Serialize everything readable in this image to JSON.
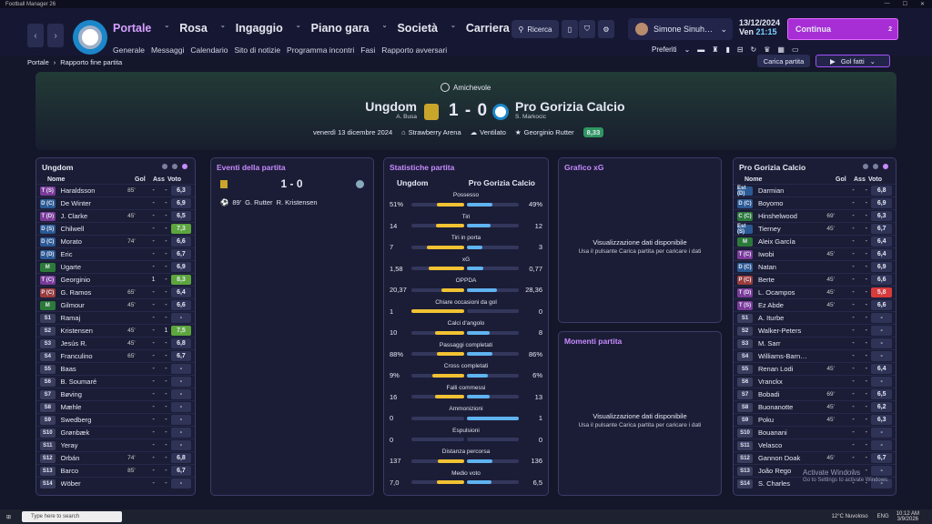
{
  "window": {
    "title": "Football Manager 26"
  },
  "nav": {
    "menu": [
      "Portale",
      "Rosa",
      "Ingaggio",
      "Piano gara",
      "Società",
      "Carriera"
    ],
    "submenu": [
      "Generale",
      "Messaggi",
      "Calendario",
      "Sito di notizie",
      "Programma incontri",
      "Fasi",
      "Rapporto avversari"
    ],
    "search": "Ricerca",
    "manager": "Simone Sinuh…",
    "date": "13/12/2024",
    "day": "Ven",
    "time": "21:15",
    "continue": "Continua",
    "notif": "2",
    "preferiti": "Preferiti"
  },
  "breadcrumb": [
    "Portale",
    "Rapporto fine partita"
  ],
  "actions": {
    "carica": "Carica partita",
    "gol": "Gol fatti"
  },
  "match": {
    "competition": "Amichevole",
    "home": "Ungdom",
    "home_coach": "A. Busa",
    "away": "Pro Gorizia Calcio",
    "away_coach": "S. Markocic",
    "score": "1 - 0",
    "date": "venerdì 13 dicembre 2024",
    "stadium": "Strawberry Arena",
    "weather": "Ventilato",
    "motm": "Georginio Rutter",
    "motm_rating": "8,33"
  },
  "home_panel": {
    "title": "Ungdom",
    "cols": [
      "Nome",
      "Gol",
      "Ass",
      "Voto"
    ],
    "players": [
      {
        "pos": "T (S)",
        "name": "Haraldsson",
        "sub": "85'",
        "gol": "-",
        "ass": "-",
        "r": "6,3",
        "c": ""
      },
      {
        "pos": "D (C)",
        "name": "De Winter",
        "sub": "",
        "gol": "-",
        "ass": "-",
        "r": "6,9",
        "c": ""
      },
      {
        "pos": "T (D)",
        "name": "J. Clarke",
        "sub": "45'",
        "gol": "-",
        "ass": "-",
        "r": "6,5",
        "c": ""
      },
      {
        "pos": "D (S)",
        "name": "Chilwell",
        "sub": "",
        "gol": "-",
        "ass": "-",
        "r": "7,3",
        "c": "g"
      },
      {
        "pos": "D (C)",
        "name": "Morato",
        "sub": "74'",
        "gol": "-",
        "ass": "-",
        "r": "6,6",
        "c": ""
      },
      {
        "pos": "D (D)",
        "name": "Eric",
        "sub": "",
        "gol": "-",
        "ass": "-",
        "r": "6,7",
        "c": ""
      },
      {
        "pos": "M",
        "name": "Ugarte",
        "sub": "",
        "gol": "-",
        "ass": "-",
        "r": "6,9",
        "c": ""
      },
      {
        "pos": "T (C)",
        "name": "Georginio",
        "sub": "",
        "gol": "1",
        "ass": "-",
        "r": "8,3",
        "c": "g"
      },
      {
        "pos": "P (C)",
        "name": "G. Ramos",
        "sub": "65'",
        "gol": "-",
        "ass": "-",
        "r": "6,4",
        "c": ""
      },
      {
        "pos": "M",
        "name": "Gilmour",
        "sub": "45'",
        "gol": "-",
        "ass": "-",
        "r": "6,6",
        "c": ""
      },
      {
        "pos": "S1",
        "name": "Ramaj",
        "sub": "",
        "gol": "-",
        "ass": "-",
        "r": "-",
        "c": ""
      },
      {
        "pos": "S2",
        "name": "Kristensen",
        "sub": "45'",
        "gol": "-",
        "ass": "1",
        "r": "7,5",
        "c": "g"
      },
      {
        "pos": "S3",
        "name": "Jesús R.",
        "sub": "45'",
        "gol": "-",
        "ass": "-",
        "r": "6,8",
        "c": ""
      },
      {
        "pos": "S4",
        "name": "Franculino",
        "sub": "65'",
        "gol": "-",
        "ass": "-",
        "r": "6,7",
        "c": ""
      },
      {
        "pos": "S5",
        "name": "Baas",
        "sub": "",
        "gol": "-",
        "ass": "-",
        "r": "-",
        "c": ""
      },
      {
        "pos": "S6",
        "name": "B. Soumaré",
        "sub": "",
        "gol": "-",
        "ass": "-",
        "r": "-",
        "c": ""
      },
      {
        "pos": "S7",
        "name": "Bøving",
        "sub": "",
        "gol": "-",
        "ass": "-",
        "r": "-",
        "c": ""
      },
      {
        "pos": "S8",
        "name": "Mæhle",
        "sub": "",
        "gol": "-",
        "ass": "-",
        "r": "-",
        "c": ""
      },
      {
        "pos": "S9",
        "name": "Swedberg",
        "sub": "",
        "gol": "-",
        "ass": "-",
        "r": "-",
        "c": ""
      },
      {
        "pos": "S10",
        "name": "Grønbæk",
        "sub": "",
        "gol": "-",
        "ass": "-",
        "r": "-",
        "c": ""
      },
      {
        "pos": "S11",
        "name": "Yeray",
        "sub": "",
        "gol": "-",
        "ass": "-",
        "r": "-",
        "c": ""
      },
      {
        "pos": "S12",
        "name": "Orbán",
        "sub": "74'",
        "gol": "-",
        "ass": "-",
        "r": "6,8",
        "c": ""
      },
      {
        "pos": "S13",
        "name": "Barco",
        "sub": "85'",
        "gol": "-",
        "ass": "-",
        "r": "6,7",
        "c": ""
      },
      {
        "pos": "S14",
        "name": "Wöber",
        "sub": "",
        "gol": "-",
        "ass": "-",
        "r": "-",
        "c": ""
      }
    ]
  },
  "away_panel": {
    "title": "Pro Gorizia Calcio",
    "cols": [
      "Nome",
      "Gol",
      "Ass",
      "Voto"
    ],
    "players": [
      {
        "pos": "Est (D)",
        "name": "Darmian",
        "sub": "",
        "gol": "-",
        "ass": "-",
        "r": "6,8",
        "c": ""
      },
      {
        "pos": "D (C)",
        "name": "Boyomo",
        "sub": "",
        "gol": "-",
        "ass": "-",
        "r": "6,9",
        "c": ""
      },
      {
        "pos": "C (C)",
        "name": "Hinshelwood",
        "sub": "69'",
        "gol": "-",
        "ass": "-",
        "r": "6,3",
        "c": ""
      },
      {
        "pos": "Est (S)",
        "name": "Tierney",
        "sub": "45'",
        "gol": "-",
        "ass": "-",
        "r": "6,7",
        "c": ""
      },
      {
        "pos": "M",
        "name": "Aleix García",
        "sub": "",
        "gol": "-",
        "ass": "-",
        "r": "6,4",
        "c": ""
      },
      {
        "pos": "T (C)",
        "name": "Iwobi",
        "sub": "45'",
        "gol": "-",
        "ass": "-",
        "r": "6,4",
        "c": ""
      },
      {
        "pos": "D (C)",
        "name": "Natan",
        "sub": "",
        "gol": "-",
        "ass": "-",
        "r": "6,9",
        "c": ""
      },
      {
        "pos": "P (C)",
        "name": "Berte",
        "sub": "45'",
        "gol": "-",
        "ass": "-",
        "r": "6,6",
        "c": ""
      },
      {
        "pos": "T (D)",
        "name": "L. Ocampos",
        "sub": "45'",
        "gol": "-",
        "ass": "-",
        "r": "5,8",
        "c": "r"
      },
      {
        "pos": "T (S)",
        "name": "Ez Abde",
        "sub": "45'",
        "gol": "-",
        "ass": "-",
        "r": "6,6",
        "c": ""
      },
      {
        "pos": "S1",
        "name": "A. Iturbe",
        "sub": "",
        "gol": "-",
        "ass": "-",
        "r": "-",
        "c": ""
      },
      {
        "pos": "S2",
        "name": "Walker-Peters",
        "sub": "",
        "gol": "-",
        "ass": "-",
        "r": "-",
        "c": ""
      },
      {
        "pos": "S3",
        "name": "M. Sarr",
        "sub": "",
        "gol": "-",
        "ass": "-",
        "r": "-",
        "c": ""
      },
      {
        "pos": "S4",
        "name": "Williams-Barn…",
        "sub": "",
        "gol": "-",
        "ass": "-",
        "r": "-",
        "c": ""
      },
      {
        "pos": "S5",
        "name": "Renan Lodi",
        "sub": "45'",
        "gol": "-",
        "ass": "-",
        "r": "6,4",
        "c": ""
      },
      {
        "pos": "S6",
        "name": "Vranckx",
        "sub": "",
        "gol": "-",
        "ass": "-",
        "r": "-",
        "c": ""
      },
      {
        "pos": "S7",
        "name": "Bobadi",
        "sub": "69'",
        "gol": "-",
        "ass": "-",
        "r": "6,5",
        "c": ""
      },
      {
        "pos": "S8",
        "name": "Buonanotte",
        "sub": "45'",
        "gol": "-",
        "ass": "-",
        "r": "6,2",
        "c": ""
      },
      {
        "pos": "S9",
        "name": "Poku",
        "sub": "45'",
        "gol": "-",
        "ass": "-",
        "r": "6,3",
        "c": ""
      },
      {
        "pos": "S10",
        "name": "Bouanani",
        "sub": "",
        "gol": "-",
        "ass": "-",
        "r": "-",
        "c": ""
      },
      {
        "pos": "S11",
        "name": "Velasco",
        "sub": "",
        "gol": "-",
        "ass": "-",
        "r": "-",
        "c": ""
      },
      {
        "pos": "S12",
        "name": "Gannon Doak",
        "sub": "45'",
        "gol": "-",
        "ass": "-",
        "r": "6,7",
        "c": ""
      },
      {
        "pos": "S13",
        "name": "João Rego",
        "sub": "",
        "gol": "-",
        "ass": "-",
        "r": "-",
        "c": ""
      },
      {
        "pos": "S14",
        "name": "S. Charles",
        "sub": "",
        "gol": "-",
        "ass": "-",
        "r": "-",
        "c": ""
      }
    ]
  },
  "events": {
    "title": "Eventi della partita",
    "score": "1 - 0",
    "items": [
      {
        "min": "89'",
        "scorer": "G. Rutter",
        "assist": "R. Kristensen"
      }
    ]
  },
  "stats": {
    "title": "Statistiche partita",
    "home": "Ungdom",
    "away": "Pro Gorizia Calcio",
    "rows": [
      {
        "label": "Possesso",
        "h": "51%",
        "a": "49%",
        "hv": 51,
        "av": 49
      },
      {
        "label": "Tiri",
        "h": "14",
        "a": "12",
        "hv": 14,
        "av": 12
      },
      {
        "label": "Tiri in porta",
        "h": "7",
        "a": "3",
        "hv": 7,
        "av": 3
      },
      {
        "label": "xG",
        "h": "1,58",
        "a": "0,77",
        "hv": 1.58,
        "av": 0.77
      },
      {
        "label": "OPPDA",
        "h": "20,37",
        "a": "28,36",
        "hv": 20.37,
        "av": 28.36
      },
      {
        "label": "Chiare occasioni da gol",
        "h": "1",
        "a": "0",
        "hv": 1,
        "av": 0
      },
      {
        "label": "Calci d'angolo",
        "h": "10",
        "a": "8",
        "hv": 10,
        "av": 8
      },
      {
        "label": "Passaggi completati",
        "h": "88%",
        "a": "86%",
        "hv": 88,
        "av": 86
      },
      {
        "label": "Cross completati",
        "h": "9%",
        "a": "6%",
        "hv": 9,
        "av": 6
      },
      {
        "label": "Falli commessi",
        "h": "16",
        "a": "13",
        "hv": 16,
        "av": 13
      },
      {
        "label": "Ammonizioni",
        "h": "0",
        "a": "1",
        "hv": 0,
        "av": 1
      },
      {
        "label": "Espulsioni",
        "h": "0",
        "a": "0",
        "hv": 0,
        "av": 0
      },
      {
        "label": "Distanza percorsa",
        "h": "137",
        "a": "136",
        "hv": 137,
        "av": 136
      },
      {
        "label": "Medio voto",
        "h": "7,0",
        "a": "6,5",
        "hv": 7.0,
        "av": 6.5
      }
    ]
  },
  "xg": {
    "title": "Grafico xG",
    "msg": "Visualizzazione dati disponibile",
    "hint": "Usa il pulsante Carica partita per caricare i dati"
  },
  "moments": {
    "title": "Momenti partita",
    "msg": "Visualizzazione dati disponibile",
    "hint": "Usa il pulsante Carica partita per caricare i dati"
  },
  "taskbar": {
    "search": "Type here to search",
    "weather": "12°C Nuvoloso",
    "lang": "ENG",
    "time": "10:12 AM",
    "date": "3/9/2026"
  },
  "watermark": {
    "title": "Activate Windows",
    "sub": "Go to Settings to activate Windows."
  }
}
